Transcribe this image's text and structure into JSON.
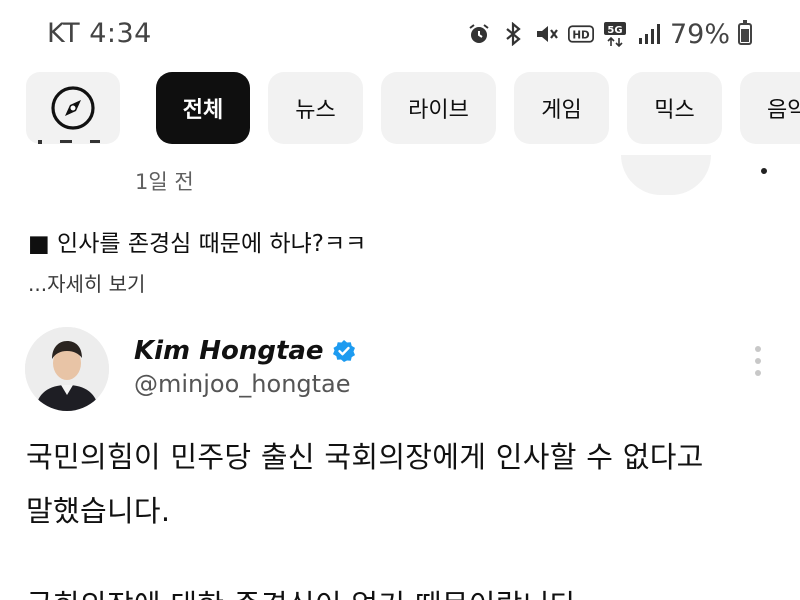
{
  "status_bar": {
    "carrier": "KT",
    "time": "4:34",
    "battery": "79%",
    "icons": [
      "alarm-icon",
      "bluetooth-icon",
      "mute-icon",
      "hd-icon",
      "5g-icon",
      "signal-icon",
      "battery-icon"
    ],
    "hd_label": "HD",
    "fiveg_label": "5G"
  },
  "chips": {
    "items": [
      {
        "label": "전체",
        "active": true
      },
      {
        "label": "뉴스"
      },
      {
        "label": "라이브"
      },
      {
        "label": "게임"
      },
      {
        "label": "믹스"
      },
      {
        "label": "음악"
      }
    ]
  },
  "previous_post": {
    "time": "1일 전"
  },
  "post": {
    "text": "■ 인사를 존경심 때문에 하냐?ㅋㅋ",
    "more": "...자세히 보기"
  },
  "tweet": {
    "author": "Kim Hongtae",
    "handle": "@minjoo_hongtae",
    "lines": [
      "국민의힘이 민주당 출신 국회의장에게 인사할 수 없다고",
      "말했습니다.",
      "",
      "국회의장에 대한 존경심이 없기 때문이랍니다."
    ]
  },
  "colors": {
    "active_chip": "#0f0f0f",
    "chip_bg": "#f2f2f2",
    "verified": "#1d9bf0"
  }
}
